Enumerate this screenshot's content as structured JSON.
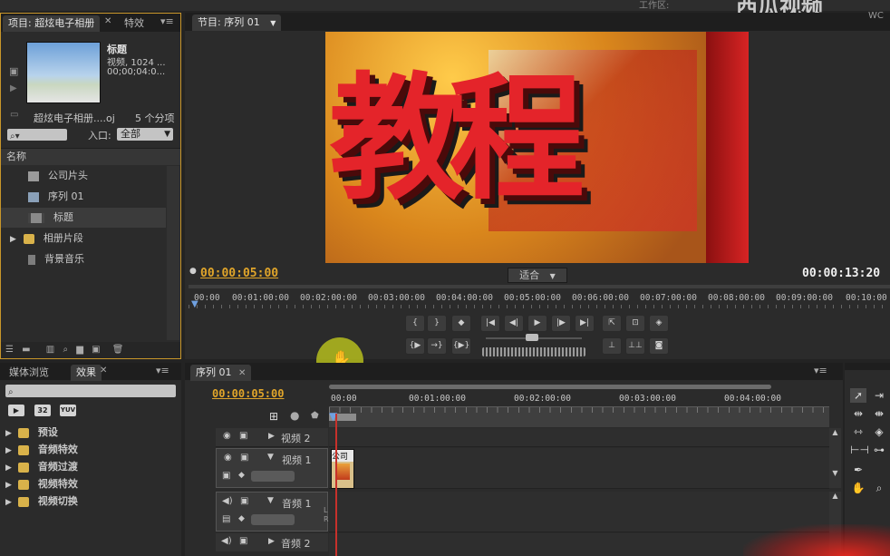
{
  "top": {
    "workspace_label": "工作区:",
    "watermark": "西瓜视频"
  },
  "project": {
    "tabs": [
      "项目: 超炫电子相册",
      "特效"
    ],
    "clip_name": "标题",
    "clip_info1": "视频, 1024 ...",
    "clip_info2": "00;00;04:0...",
    "project_file": "超炫电子相册....oj",
    "item_count": "5 个分项",
    "entry_label": "入口:",
    "entry_value": "全部",
    "column_name": "名称",
    "items": [
      {
        "label": "公司片头",
        "icon": "sequence-icon"
      },
      {
        "label": "序列 01",
        "icon": "sequence-icon"
      },
      {
        "label": "标题",
        "icon": "title-icon"
      },
      {
        "label": "相册片段",
        "icon": "folder-icon"
      },
      {
        "label": "背景音乐",
        "icon": "audio-icon"
      }
    ]
  },
  "monitor": {
    "tab": "节目: 序列 01",
    "current_tc": "00:00:05:00",
    "duration_tc": "00:00:13:20",
    "fit_value": "适合",
    "ruler": [
      "00:00",
      "00:01:00:00",
      "00:02:00:00",
      "00:03:00:00",
      "00:04:00:00",
      "00:05:00:00",
      "00:06:00:00",
      "00:07:00:00",
      "00:08:00:00",
      "00:09:00:00",
      "00:10:00"
    ],
    "frame_text": "教程"
  },
  "effects": {
    "tabs": [
      "媒体浏览",
      "效果"
    ],
    "presets": [
      "32",
      "YUV"
    ],
    "folders": [
      "预设",
      "音频特效",
      "音频过渡",
      "视频特效",
      "视频切换"
    ]
  },
  "timeline": {
    "tab": "序列 01",
    "current_tc": "00:00:05:00",
    "ruler": [
      "00:00",
      "00:01:00:00",
      "00:02:00:00",
      "00:03:00:00",
      "00:04:00:00"
    ],
    "tracks": [
      {
        "name": "视频 2"
      },
      {
        "name": "视频 1"
      },
      {
        "name": "音频 1"
      },
      {
        "name": "音频 2"
      }
    ],
    "clip_label": "公司"
  },
  "colors": {
    "accent_tc": "#e0a52a",
    "playhead": "#c7312b",
    "highlight": "#c8d11c"
  }
}
